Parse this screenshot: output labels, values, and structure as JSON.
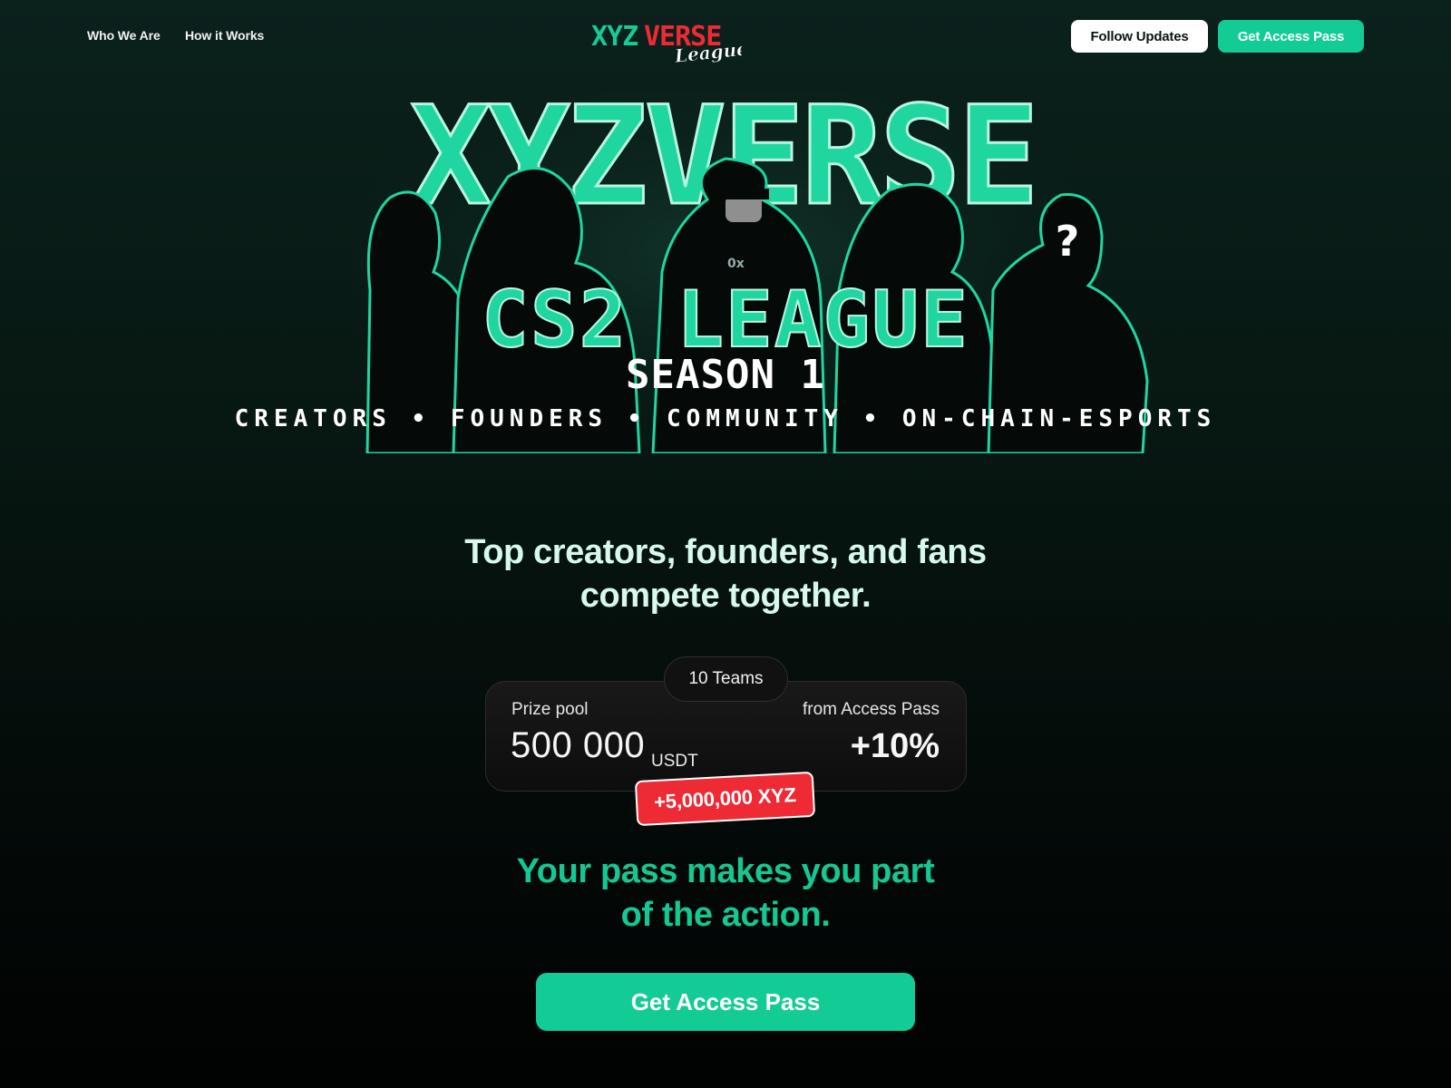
{
  "nav": {
    "links": [
      {
        "label": "Who We Are"
      },
      {
        "label": "How it Works"
      }
    ],
    "logo": {
      "word_a": "XYZ",
      "word_b": "VERSE",
      "script": "League"
    },
    "follow_label": "Follow Updates",
    "access_label": "Get Access Pass"
  },
  "hero": {
    "title": "XYZVERSE",
    "league": "CS2 LEAGUE",
    "season": "SEASON 1",
    "tagline": "CREATORS • FOUNDERS • COMMUNITY •  ON-CHAIN-ESPORTS",
    "mystery_mark": "?",
    "jacket_mark": "0x"
  },
  "headline": {
    "line1": "Top creators, founders, and fans",
    "line2": "compete together."
  },
  "prize": {
    "teams": "10 Teams",
    "pool_label": "Prize pool",
    "pool_value": "500 000",
    "pool_unit": "USDT",
    "pass_label": "from Access Pass",
    "pass_value": "+10%",
    "bonus": "+5,000,000 XYZ"
  },
  "subhead": {
    "line1": "Your pass makes you part",
    "line2": "of the action."
  },
  "cta": {
    "label": "Get Access Pass"
  },
  "colors": {
    "accent": "#12cb95",
    "hero_green": "#1fd6a0",
    "badge_red": "#ee2a35",
    "headline": "#d6f8ed"
  },
  "icons": [
    "xyzverse-logo",
    "question-mark-icon"
  ]
}
